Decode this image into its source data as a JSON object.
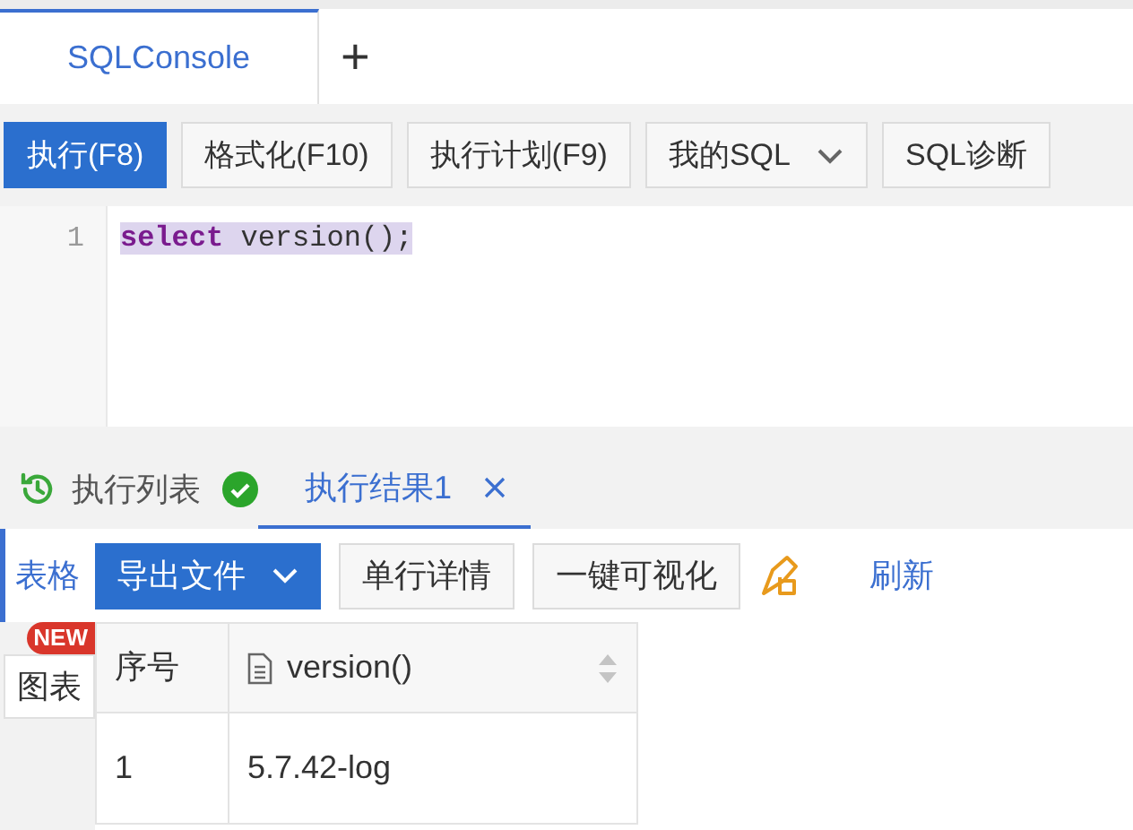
{
  "editor_tabs": [
    {
      "label": "SQLConsole",
      "selected": true
    }
  ],
  "add_tab": "+",
  "toolbar": [
    {
      "label": "执行(F8)",
      "primary": true,
      "dropdown": false
    },
    {
      "label": "格式化(F10)",
      "primary": false,
      "dropdown": false
    },
    {
      "label": "执行计划(F9)",
      "primary": false,
      "dropdown": false
    },
    {
      "label": "我的SQL",
      "primary": false,
      "dropdown": true
    },
    {
      "label": "SQL诊断",
      "primary": false,
      "dropdown": false
    }
  ],
  "editor": {
    "lines": [
      {
        "number": "1",
        "keyword": "select",
        "rest": " version();"
      }
    ]
  },
  "result_tabs": [
    {
      "kind": "history",
      "label": "执行列表",
      "selected": false,
      "success": true
    },
    {
      "kind": "result",
      "label": "执行结果1",
      "selected": true,
      "closable": true
    }
  ],
  "side_tabs": [
    {
      "label": "表格",
      "selected": true
    },
    {
      "label": "图表",
      "selected": false,
      "badge": "NEW"
    }
  ],
  "result_toolbar": [
    {
      "label": "导出文件",
      "kind": "primary-dropdown"
    },
    {
      "label": "单行详情",
      "kind": "button"
    },
    {
      "label": "一键可视化",
      "kind": "button"
    },
    {
      "kind": "icon"
    },
    {
      "label": "刷新",
      "kind": "link"
    }
  ],
  "table": {
    "columns": [
      {
        "label": "序号",
        "file_icon": false,
        "sortable": false
      },
      {
        "label": "version()",
        "file_icon": true,
        "sortable": true
      }
    ],
    "rows": [
      [
        "1",
        "5.7.42-log"
      ]
    ]
  }
}
